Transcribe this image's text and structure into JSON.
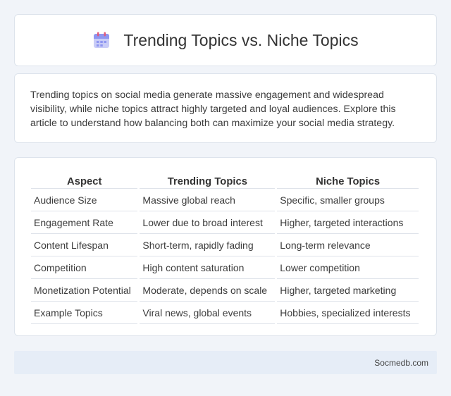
{
  "header": {
    "icon": "calendar-icon",
    "title": "Trending Topics vs. Niche Topics"
  },
  "intro": {
    "text": "Trending topics on social media generate massive engagement and widespread visibility, while niche topics attract highly targeted and loyal audiences. Explore this article to understand how balancing both can maximize your social media strategy."
  },
  "table": {
    "headers": [
      "Aspect",
      "Trending Topics",
      "Niche Topics"
    ],
    "rows": [
      [
        "Audience Size",
        "Massive global reach",
        "Specific, smaller groups"
      ],
      [
        "Engagement Rate",
        "Lower due to broad interest",
        "Higher, targeted interactions"
      ],
      [
        "Content Lifespan",
        "Short-term, rapidly fading",
        "Long-term relevance"
      ],
      [
        "Competition",
        "High content saturation",
        "Lower competition"
      ],
      [
        "Monetization Potential",
        "Moderate, depends on scale",
        "Higher, targeted marketing"
      ],
      [
        "Example Topics",
        "Viral news, global events",
        "Hobbies, specialized interests"
      ]
    ]
  },
  "footer": {
    "site": "Socmedb.com"
  },
  "colors": {
    "background": "#f1f4f9",
    "card": "#ffffff",
    "footer": "#e6edf7",
    "icon_accent": "#e25b7b",
    "icon_body": "#8f96f0"
  }
}
